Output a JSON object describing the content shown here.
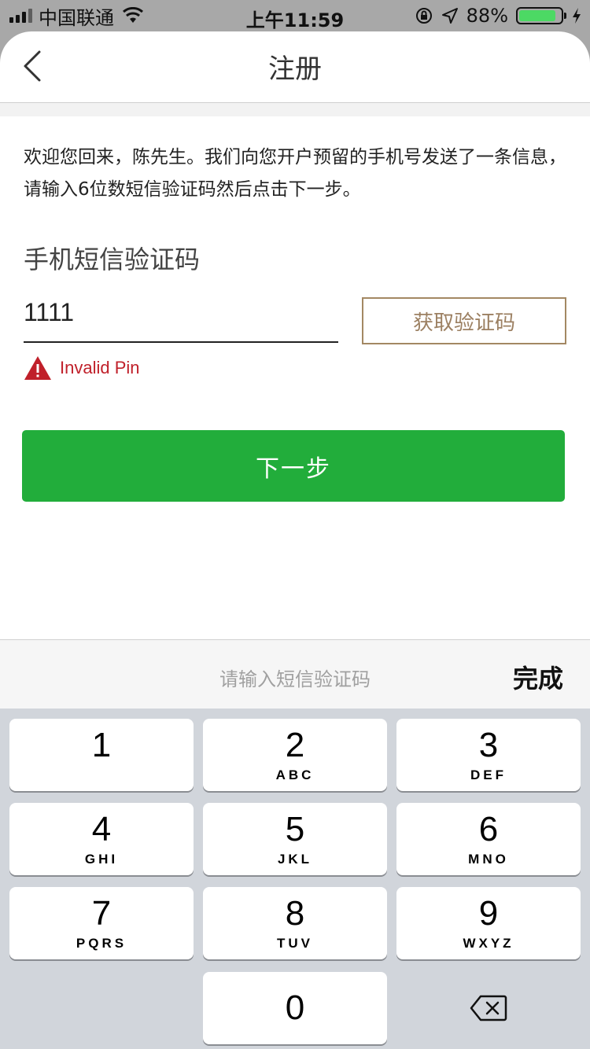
{
  "status_bar": {
    "carrier": "中国联通",
    "time": "上午11:59",
    "battery_percent": "88%",
    "battery_level": 0.88
  },
  "nav": {
    "title": "注册",
    "back_icon": "chevron-left-icon"
  },
  "content": {
    "intro_text": "欢迎您回来，陈先生。我们向您开户预留的手机号发送了一条信息，请输入6位数短信验证码然后点击下一步。",
    "field_label": "手机短信验证码",
    "pin_value": "1111",
    "get_code_label": "获取验证码",
    "error_text": "Invalid Pin",
    "next_label": "下一步"
  },
  "keyboard": {
    "placeholder": "请输入短信验证码",
    "done_label": "完成",
    "keys": [
      {
        "num": "1",
        "letters": ""
      },
      {
        "num": "2",
        "letters": "ABC"
      },
      {
        "num": "3",
        "letters": "DEF"
      },
      {
        "num": "4",
        "letters": "GHI"
      },
      {
        "num": "5",
        "letters": "JKL"
      },
      {
        "num": "6",
        "letters": "MNO"
      },
      {
        "num": "7",
        "letters": "PQRS"
      },
      {
        "num": "8",
        "letters": "TUV"
      },
      {
        "num": "9",
        "letters": "WXYZ"
      },
      {
        "num": "0",
        "letters": ""
      }
    ]
  },
  "colors": {
    "primary_green": "#22ad3b",
    "gold_border": "#a38863",
    "error_red": "#c0202a"
  }
}
